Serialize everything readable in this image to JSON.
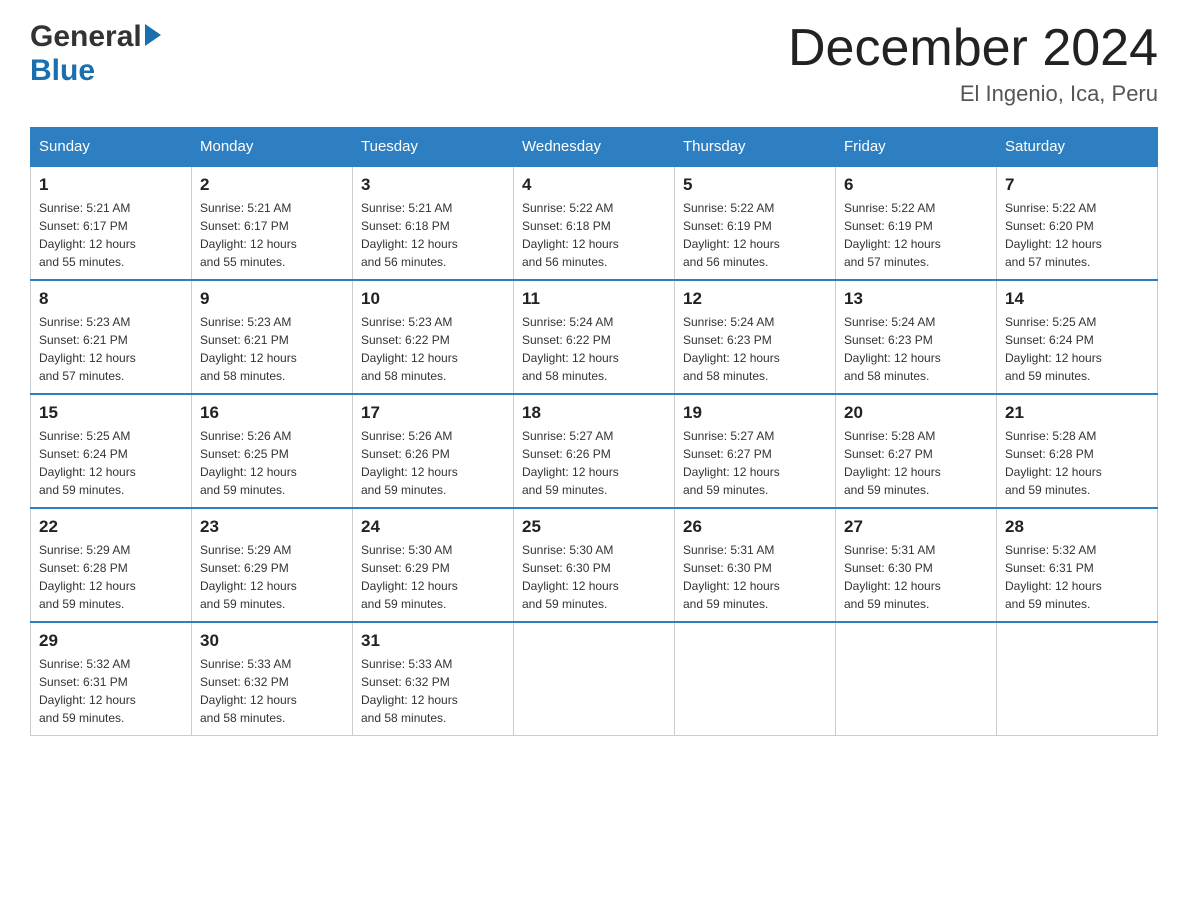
{
  "header": {
    "logo_general": "General",
    "logo_blue": "Blue",
    "month_title": "December 2024",
    "location": "El Ingenio, Ica, Peru"
  },
  "weekdays": [
    "Sunday",
    "Monday",
    "Tuesday",
    "Wednesday",
    "Thursday",
    "Friday",
    "Saturday"
  ],
  "weeks": [
    [
      {
        "day": "1",
        "sunrise": "5:21 AM",
        "sunset": "6:17 PM",
        "daylight": "12 hours and 55 minutes."
      },
      {
        "day": "2",
        "sunrise": "5:21 AM",
        "sunset": "6:17 PM",
        "daylight": "12 hours and 55 minutes."
      },
      {
        "day": "3",
        "sunrise": "5:21 AM",
        "sunset": "6:18 PM",
        "daylight": "12 hours and 56 minutes."
      },
      {
        "day": "4",
        "sunrise": "5:22 AM",
        "sunset": "6:18 PM",
        "daylight": "12 hours and 56 minutes."
      },
      {
        "day": "5",
        "sunrise": "5:22 AM",
        "sunset": "6:19 PM",
        "daylight": "12 hours and 56 minutes."
      },
      {
        "day": "6",
        "sunrise": "5:22 AM",
        "sunset": "6:19 PM",
        "daylight": "12 hours and 57 minutes."
      },
      {
        "day": "7",
        "sunrise": "5:22 AM",
        "sunset": "6:20 PM",
        "daylight": "12 hours and 57 minutes."
      }
    ],
    [
      {
        "day": "8",
        "sunrise": "5:23 AM",
        "sunset": "6:21 PM",
        "daylight": "12 hours and 57 minutes."
      },
      {
        "day": "9",
        "sunrise": "5:23 AM",
        "sunset": "6:21 PM",
        "daylight": "12 hours and 58 minutes."
      },
      {
        "day": "10",
        "sunrise": "5:23 AM",
        "sunset": "6:22 PM",
        "daylight": "12 hours and 58 minutes."
      },
      {
        "day": "11",
        "sunrise": "5:24 AM",
        "sunset": "6:22 PM",
        "daylight": "12 hours and 58 minutes."
      },
      {
        "day": "12",
        "sunrise": "5:24 AM",
        "sunset": "6:23 PM",
        "daylight": "12 hours and 58 minutes."
      },
      {
        "day": "13",
        "sunrise": "5:24 AM",
        "sunset": "6:23 PM",
        "daylight": "12 hours and 58 minutes."
      },
      {
        "day": "14",
        "sunrise": "5:25 AM",
        "sunset": "6:24 PM",
        "daylight": "12 hours and 59 minutes."
      }
    ],
    [
      {
        "day": "15",
        "sunrise": "5:25 AM",
        "sunset": "6:24 PM",
        "daylight": "12 hours and 59 minutes."
      },
      {
        "day": "16",
        "sunrise": "5:26 AM",
        "sunset": "6:25 PM",
        "daylight": "12 hours and 59 minutes."
      },
      {
        "day": "17",
        "sunrise": "5:26 AM",
        "sunset": "6:26 PM",
        "daylight": "12 hours and 59 minutes."
      },
      {
        "day": "18",
        "sunrise": "5:27 AM",
        "sunset": "6:26 PM",
        "daylight": "12 hours and 59 minutes."
      },
      {
        "day": "19",
        "sunrise": "5:27 AM",
        "sunset": "6:27 PM",
        "daylight": "12 hours and 59 minutes."
      },
      {
        "day": "20",
        "sunrise": "5:28 AM",
        "sunset": "6:27 PM",
        "daylight": "12 hours and 59 minutes."
      },
      {
        "day": "21",
        "sunrise": "5:28 AM",
        "sunset": "6:28 PM",
        "daylight": "12 hours and 59 minutes."
      }
    ],
    [
      {
        "day": "22",
        "sunrise": "5:29 AM",
        "sunset": "6:28 PM",
        "daylight": "12 hours and 59 minutes."
      },
      {
        "day": "23",
        "sunrise": "5:29 AM",
        "sunset": "6:29 PM",
        "daylight": "12 hours and 59 minutes."
      },
      {
        "day": "24",
        "sunrise": "5:30 AM",
        "sunset": "6:29 PM",
        "daylight": "12 hours and 59 minutes."
      },
      {
        "day": "25",
        "sunrise": "5:30 AM",
        "sunset": "6:30 PM",
        "daylight": "12 hours and 59 minutes."
      },
      {
        "day": "26",
        "sunrise": "5:31 AM",
        "sunset": "6:30 PM",
        "daylight": "12 hours and 59 minutes."
      },
      {
        "day": "27",
        "sunrise": "5:31 AM",
        "sunset": "6:30 PM",
        "daylight": "12 hours and 59 minutes."
      },
      {
        "day": "28",
        "sunrise": "5:32 AM",
        "sunset": "6:31 PM",
        "daylight": "12 hours and 59 minutes."
      }
    ],
    [
      {
        "day": "29",
        "sunrise": "5:32 AM",
        "sunset": "6:31 PM",
        "daylight": "12 hours and 59 minutes."
      },
      {
        "day": "30",
        "sunrise": "5:33 AM",
        "sunset": "6:32 PM",
        "daylight": "12 hours and 58 minutes."
      },
      {
        "day": "31",
        "sunrise": "5:33 AM",
        "sunset": "6:32 PM",
        "daylight": "12 hours and 58 minutes."
      },
      null,
      null,
      null,
      null
    ]
  ]
}
